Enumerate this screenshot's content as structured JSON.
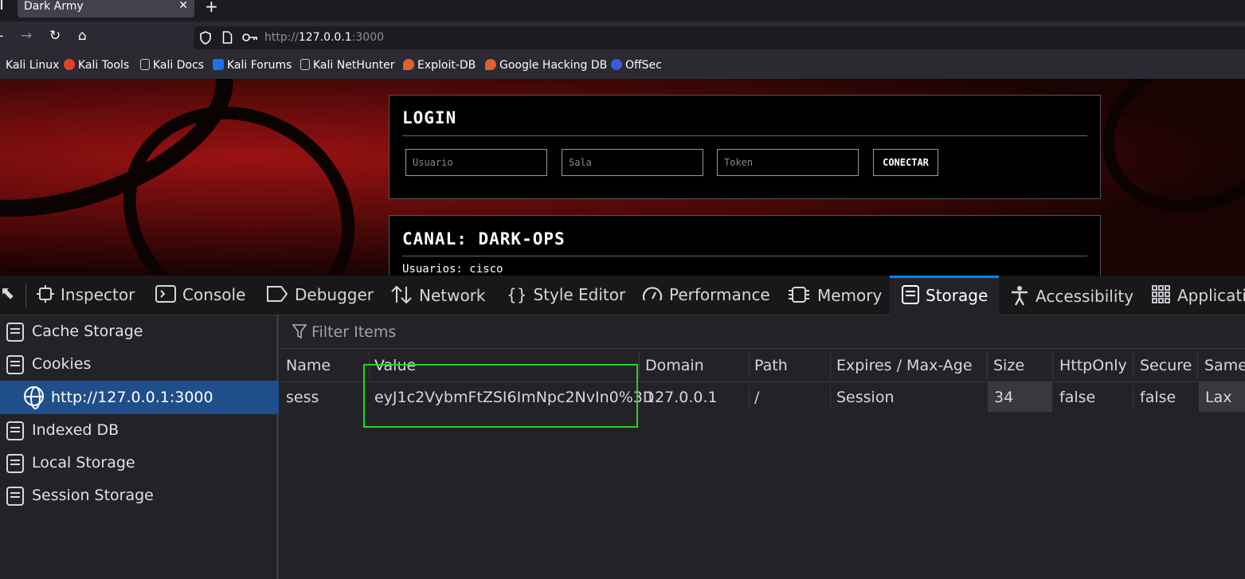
{
  "browser": {
    "tab_title": "Dark Army",
    "tab_close": "✕",
    "new_tab": "+",
    "url_scheme": "http://",
    "url_host": "127.0.0.1",
    "url_port": ":3000",
    "nav_icons": [
      "back-icon",
      "forward-icon",
      "reload-icon",
      "home-icon",
      "shield-icon",
      "page-icon",
      "key-icon"
    ],
    "bookmarks": [
      {
        "label": "Kali Linux",
        "icon_color": "#367bf0"
      },
      {
        "label": "Kali Tools",
        "icon_color": "#e5422b"
      },
      {
        "label": "Kali Docs",
        "icon_color": "#cccccc"
      },
      {
        "label": "Kali Forums",
        "icon_color": "#1f6feb"
      },
      {
        "label": "Kali NetHunter",
        "icon_color": "#cccccc"
      },
      {
        "label": "Exploit-DB",
        "icon_color": "#e0612e"
      },
      {
        "label": "Google Hacking DB",
        "icon_color": "#e0612e"
      },
      {
        "label": "OffSec",
        "icon_color": "#3b5bdb"
      }
    ]
  },
  "page": {
    "login": {
      "title": "LOGIN",
      "user_placeholder": "Usuario",
      "room_placeholder": "Sala",
      "token_placeholder": "Token",
      "connect_label": "CONECTAR"
    },
    "channel": {
      "title": "CANAL: DARK-OPS",
      "users_line": "Usuarios: cisco"
    }
  },
  "devtools": {
    "tabs": [
      {
        "label": "Inspector",
        "icon": "inspector-icon"
      },
      {
        "label": "Console",
        "icon": "console-icon"
      },
      {
        "label": "Debugger",
        "icon": "debugger-icon"
      },
      {
        "label": "Network",
        "icon": "network-icon"
      },
      {
        "label": "Style Editor",
        "icon": "style-editor-icon"
      },
      {
        "label": "Performance",
        "icon": "performance-icon"
      },
      {
        "label": "Memory",
        "icon": "memory-icon"
      },
      {
        "label": "Storage",
        "icon": "storage-icon"
      },
      {
        "label": "Accessibility",
        "icon": "accessibility-icon"
      },
      {
        "label": "Applicati",
        "icon": "application-icon"
      }
    ],
    "active_tab": "Storage",
    "sidebar": {
      "items": [
        {
          "label": "Cache Storage"
        },
        {
          "label": "Cookies"
        },
        {
          "label": "http://127.0.0.1:3000"
        },
        {
          "label": "Indexed DB"
        },
        {
          "label": "Local Storage"
        },
        {
          "label": "Session Storage"
        }
      ]
    },
    "filter_placeholder": "Filter Items",
    "table": {
      "headers": [
        "Name",
        "Value",
        "Domain",
        "Path",
        "Expires / Max-Age",
        "Size",
        "HttpOnly",
        "Secure",
        "SameS"
      ],
      "rows": [
        {
          "name": "sess",
          "value": "eyJ1c2VybmFtZSI6ImNpc2NvIn0%3D",
          "domain": "127.0.0.1",
          "path": "/",
          "expires": "Session",
          "size": "34",
          "httponly": "false",
          "secure": "false",
          "samesite": "Lax"
        }
      ]
    },
    "highlight_color": "#22d422"
  }
}
